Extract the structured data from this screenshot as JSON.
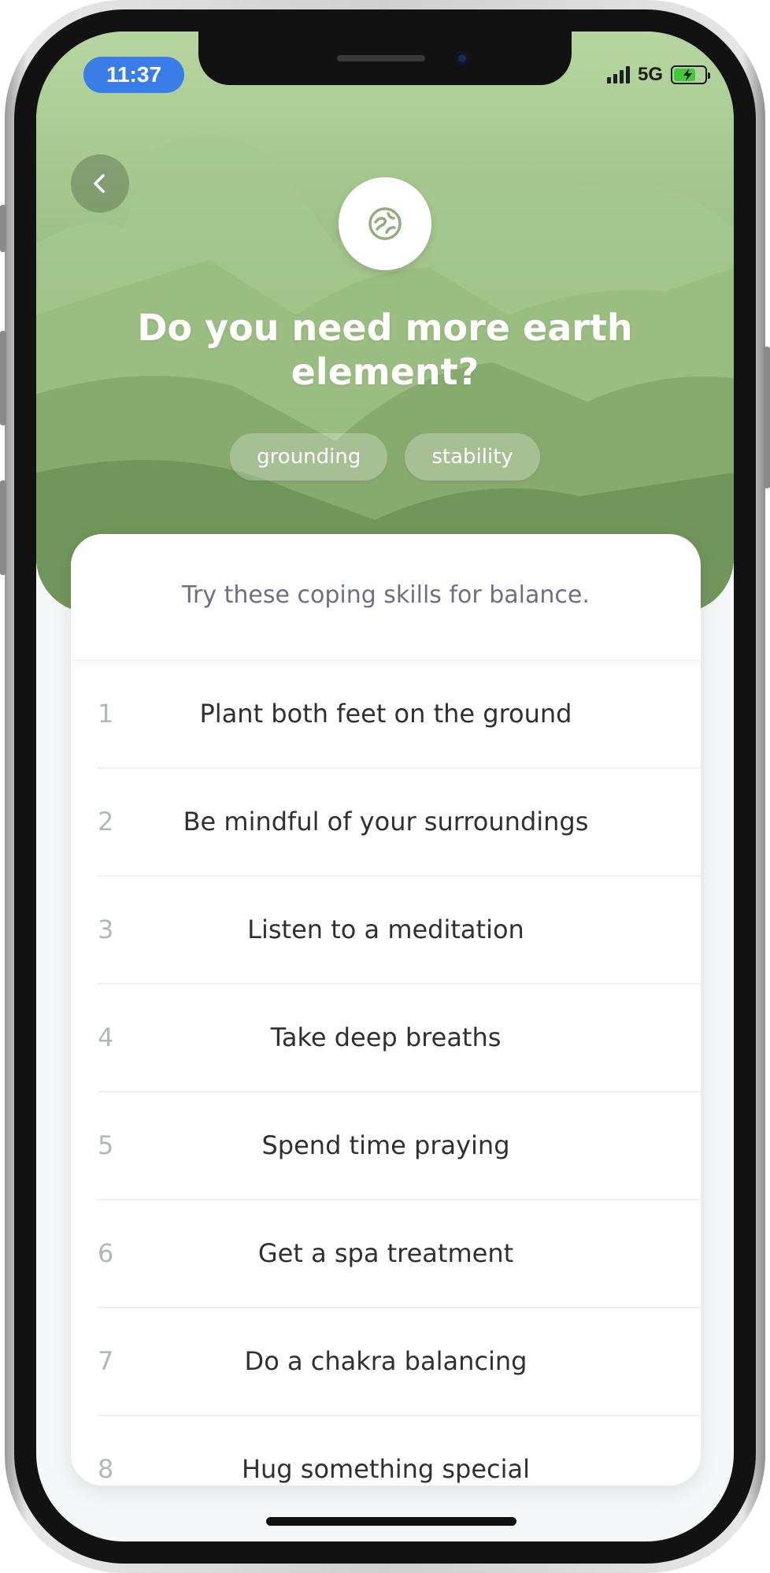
{
  "status_bar": {
    "time": "11:37",
    "network": "5G",
    "battery_level": 0.72,
    "battery_color": "#43c93d",
    "time_pill_color": "#3a7de8"
  },
  "header": {
    "back_icon": "chevron-left-icon",
    "element_icon": "earth-element-icon",
    "title": "Do you need more earth element?",
    "tags": [
      "grounding",
      "stability"
    ],
    "gradient_colors": [
      "#b7d6a1",
      "#6a8f57"
    ]
  },
  "card": {
    "intro": "Try these coping skills for balance.",
    "skills": [
      {
        "number": "1",
        "text": "Plant both feet on the ground"
      },
      {
        "number": "2",
        "text": "Be mindful of your surroundings"
      },
      {
        "number": "3",
        "text": "Listen to a meditation"
      },
      {
        "number": "4",
        "text": "Take deep breaths"
      },
      {
        "number": "5",
        "text": "Spend time praying"
      },
      {
        "number": "6",
        "text": "Get a spa treatment"
      },
      {
        "number": "7",
        "text": "Do a chakra balancing"
      },
      {
        "number": "8",
        "text": "Hug something special"
      }
    ]
  }
}
